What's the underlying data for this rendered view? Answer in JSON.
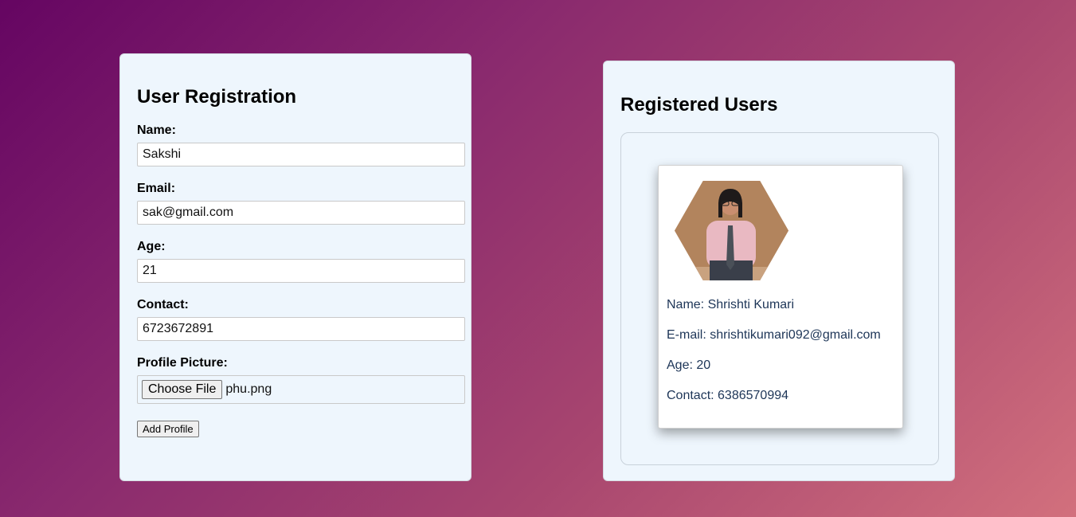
{
  "registration": {
    "title": "User Registration",
    "name_label": "Name:",
    "name_value": "Sakshi",
    "email_label": "Email:",
    "email_value": "sak@gmail.com",
    "age_label": "Age:",
    "age_value": "21",
    "contact_label": "Contact:",
    "contact_value": "6723672891",
    "picture_label": "Profile Picture:",
    "choose_file_label": "Choose File",
    "file_name": "phu.png",
    "add_button_label": "Add Profile"
  },
  "users": {
    "title": "Registered Users",
    "cards": [
      {
        "name_line": "Name: Shrishti Kumari",
        "email_line": "E-mail: shrishtikumari092@gmail.com",
        "age_line": "Age: 20",
        "contact_line": "Contact: 6386570994"
      }
    ]
  },
  "colors": {
    "panel_bg": "#eef6fd",
    "card_text": "#1d3557",
    "gradient_start": "#650562",
    "gradient_end": "#d2707d"
  }
}
